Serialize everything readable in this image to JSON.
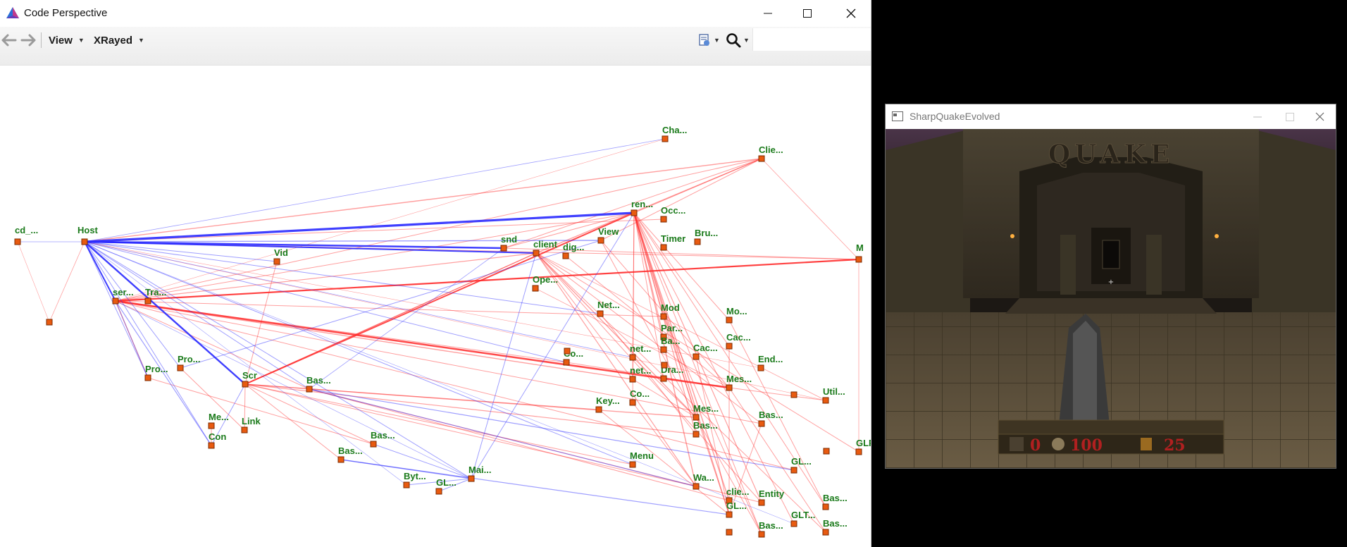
{
  "code_perspective": {
    "window_title": "Code Perspective",
    "toolbar": {
      "view_label": "View",
      "xrayed_label": "XRayed"
    },
    "graph": {
      "nodes": [
        {
          "id": "cd",
          "label": "cd_..."
        },
        {
          "id": "host",
          "label": "Host"
        },
        {
          "id": "vid",
          "label": "Vid"
        },
        {
          "id": "ser",
          "label": "ser..."
        },
        {
          "id": "tra",
          "label": "Tra..."
        },
        {
          "id": "pro1",
          "label": "Pro..."
        },
        {
          "id": "pro2",
          "label": "Pro..."
        },
        {
          "id": "scr",
          "label": "Scr"
        },
        {
          "id": "me",
          "label": "Me..."
        },
        {
          "id": "link",
          "label": "Link"
        },
        {
          "id": "con",
          "label": "Con"
        },
        {
          "id": "bas1",
          "label": "Bas..."
        },
        {
          "id": "bas2",
          "label": "Bas..."
        },
        {
          "id": "bas3",
          "label": "Bas..."
        },
        {
          "id": "byt",
          "label": "Byt..."
        },
        {
          "id": "gl1",
          "label": "GL..."
        },
        {
          "id": "mai",
          "label": "Mai..."
        },
        {
          "id": "snd",
          "label": "snd"
        },
        {
          "id": "client",
          "label": "client"
        },
        {
          "id": "dig",
          "label": "dig..."
        },
        {
          "id": "view",
          "label": "View"
        },
        {
          "id": "ope",
          "label": "Ope..."
        },
        {
          "id": "ren",
          "label": "ren..."
        },
        {
          "id": "occ",
          "label": "Occ..."
        },
        {
          "id": "cha",
          "label": "Cha..."
        },
        {
          "id": "clie",
          "label": "Clie..."
        },
        {
          "id": "bru",
          "label": "Bru..."
        },
        {
          "id": "timer",
          "label": "Timer"
        },
        {
          "id": "m",
          "label": "M"
        },
        {
          "id": "net1",
          "label": "Net..."
        },
        {
          "id": "mod",
          "label": "Mod"
        },
        {
          "id": "mo",
          "label": "Mo..."
        },
        {
          "id": "par",
          "label": "Par..."
        },
        {
          "id": "ba",
          "label": "Ba..."
        },
        {
          "id": "cac1",
          "label": "Cac..."
        },
        {
          "id": "cac2",
          "label": "Cac..."
        },
        {
          "id": "co1",
          "label": "Co..."
        },
        {
          "id": "net2",
          "label": "net..."
        },
        {
          "id": "net3",
          "label": "net..."
        },
        {
          "id": "dra",
          "label": "Dra..."
        },
        {
          "id": "end",
          "label": "End..."
        },
        {
          "id": "mes1",
          "label": "Mes..."
        },
        {
          "id": "mes2",
          "label": "Mes..."
        },
        {
          "id": "util",
          "label": "Util..."
        },
        {
          "id": "key",
          "label": "Key..."
        },
        {
          "id": "co2",
          "label": "Co..."
        },
        {
          "id": "bas4",
          "label": "Bas..."
        },
        {
          "id": "bas5",
          "label": "Bas..."
        },
        {
          "id": "menu",
          "label": "Menu"
        },
        {
          "id": "gl2",
          "label": "GL..."
        },
        {
          "id": "glp",
          "label": "GLP..."
        },
        {
          "id": "wa",
          "label": "Wa..."
        },
        {
          "id": "clie2",
          "label": "clie..."
        },
        {
          "id": "entity",
          "label": "Entity"
        },
        {
          "id": "gl3",
          "label": "GL..."
        },
        {
          "id": "glt",
          "label": "GLT..."
        },
        {
          "id": "bas6",
          "label": "Bas..."
        },
        {
          "id": "bas7",
          "label": "Bas..."
        },
        {
          "id": "bas8",
          "label": "Bas..."
        },
        {
          "id": "unl1",
          "label": ""
        },
        {
          "id": "unl2",
          "label": ""
        },
        {
          "id": "unl3",
          "label": ""
        },
        {
          "id": "unl4",
          "label": ""
        },
        {
          "id": "unl5",
          "label": ""
        },
        {
          "id": "unl6",
          "label": ""
        }
      ]
    }
  },
  "sharpquake": {
    "window_title": "SharpQuakeEvolved",
    "hud": {
      "armor": "0",
      "health": "100",
      "ammo": "25"
    }
  },
  "colors": {
    "edge_red": "#ff2a2a",
    "edge_blue": "#2a2aff",
    "node_label": "#1a7a1a",
    "node_fill": "#e85a10"
  }
}
